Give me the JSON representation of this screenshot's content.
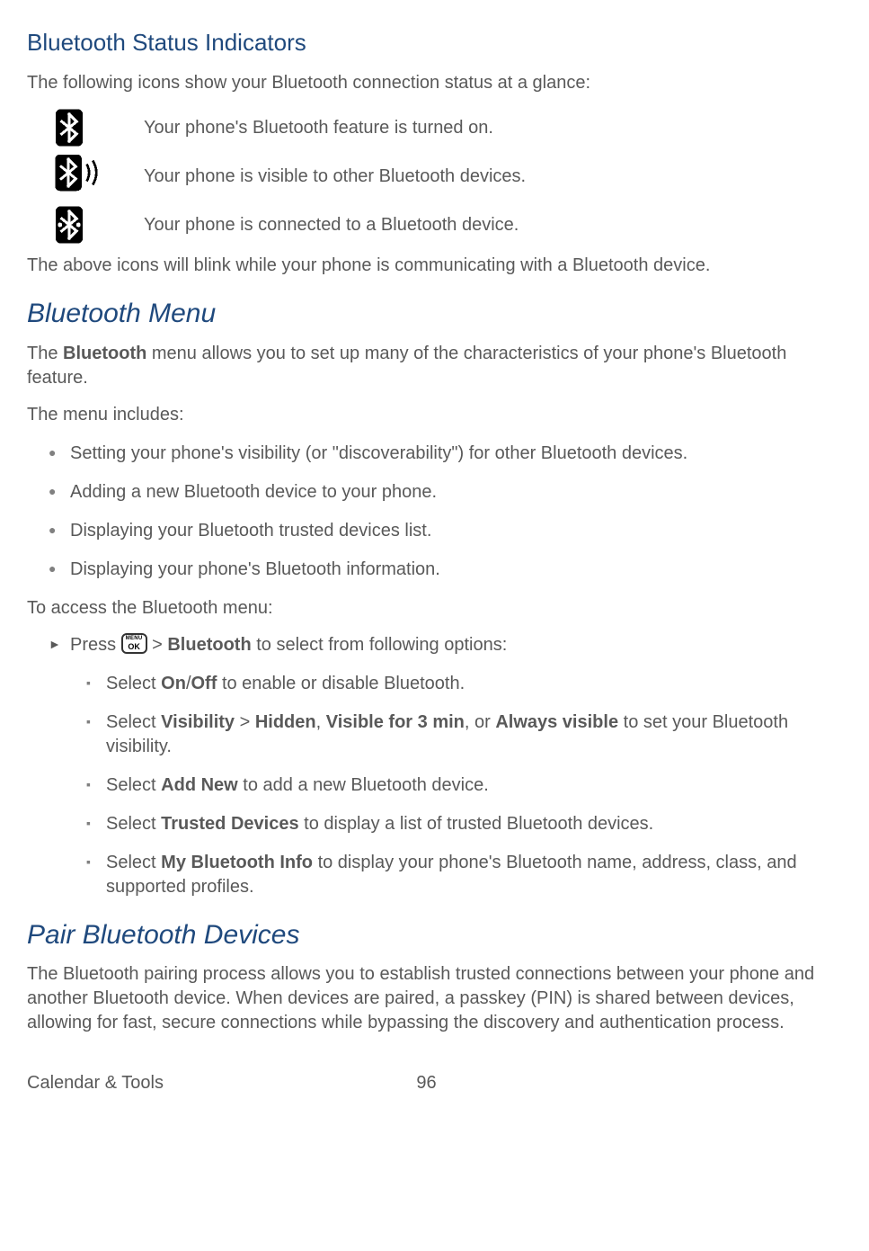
{
  "headings": {
    "status": "Bluetooth Status Indicators",
    "menu": "Bluetooth Menu",
    "pair": "Pair Bluetooth Devices"
  },
  "paragraphs": {
    "status_intro": "The following icons show your Bluetooth connection status at a glance:",
    "status_outro": "The above icons will blink while your phone is communicating with a Bluetooth device.",
    "menu_intro_pre": "The ",
    "menu_intro_bold": "Bluetooth",
    "menu_intro_post": " menu allows you to set up many of the characteristics of your phone's Bluetooth feature.",
    "menu_includes": "The menu includes:",
    "menu_access": "To access the Bluetooth menu:",
    "pair_body": "The Bluetooth pairing process allows you to establish trusted connections between your phone and another Bluetooth device. When devices are paired, a passkey (PIN) is shared between devices, allowing for fast, secure connections while bypassing the discovery and authentication process."
  },
  "icons": {
    "on": "Your phone's Bluetooth feature is turned on.",
    "visible": "Your phone is visible to other Bluetooth devices.",
    "connected": "Your phone is connected to a Bluetooth device."
  },
  "bullets": {
    "round": [
      "Setting your phone's visibility (or \"discoverability\") for other Bluetooth devices.",
      "Adding a new Bluetooth device to your phone.",
      "Displaying your Bluetooth trusted devices list.",
      "Displaying your phone's Bluetooth information."
    ]
  },
  "tri": {
    "press_pre": "Press ",
    "press_gt": " > ",
    "press_bt": "Bluetooth",
    "press_post": " to select from following options:"
  },
  "sq": {
    "i0": {
      "pre": "Select ",
      "b1": "On",
      "slash": "/",
      "b2": "Off",
      "post": " to enable or disable Bluetooth."
    },
    "i1": {
      "pre": "Select ",
      "b1": "Visibility",
      "gt": " > ",
      "b2": "Hidden",
      "c1": ", ",
      "b3": "Visible for 3 min",
      "c2": ", or ",
      "b4": "Always visible",
      "post": " to set your Bluetooth visibility."
    },
    "i2": {
      "pre": "Select ",
      "b1": "Add New",
      "post": " to add a new Bluetooth device."
    },
    "i3": {
      "pre": "Select ",
      "b1": "Trusted Devices",
      "post": " to display a list of trusted Bluetooth devices."
    },
    "i4": {
      "pre": "Select ",
      "b1": "My Bluetooth Info",
      "post": " to display your phone's Bluetooth name, address, class, and supported profiles."
    }
  },
  "key": {
    "menu": "MENU",
    "ok": "OK"
  },
  "footer": {
    "section": "Calendar & Tools",
    "page": "96"
  }
}
